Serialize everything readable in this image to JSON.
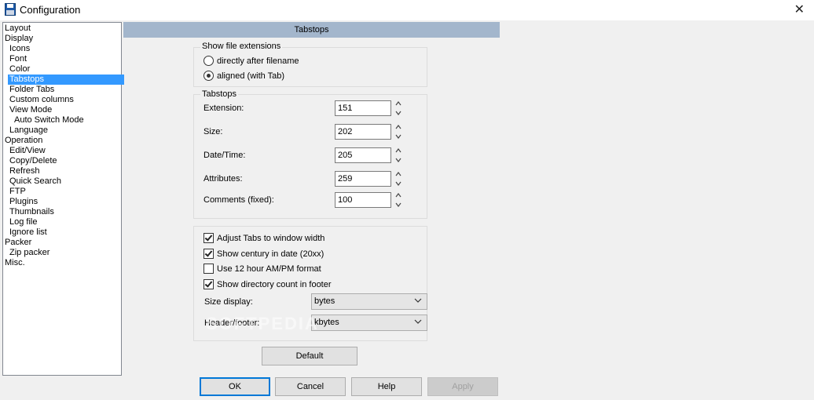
{
  "window": {
    "title": "Configuration",
    "close_glyph": "✕"
  },
  "tree": {
    "items": [
      {
        "label": "Layout",
        "indent": 0
      },
      {
        "label": "Display",
        "indent": 0
      },
      {
        "label": "Icons",
        "indent": 1
      },
      {
        "label": "Font",
        "indent": 1
      },
      {
        "label": "Color",
        "indent": 1
      },
      {
        "label": "Tabstops",
        "indent": 1,
        "selected": true
      },
      {
        "label": "Folder Tabs",
        "indent": 1
      },
      {
        "label": "Custom columns",
        "indent": 1
      },
      {
        "label": "View Mode",
        "indent": 1
      },
      {
        "label": "Auto Switch Mode",
        "indent": 2
      },
      {
        "label": "Language",
        "indent": 1
      },
      {
        "label": "Operation",
        "indent": 0
      },
      {
        "label": "Edit/View",
        "indent": 1
      },
      {
        "label": "Copy/Delete",
        "indent": 1
      },
      {
        "label": "Refresh",
        "indent": 1
      },
      {
        "label": "Quick Search",
        "indent": 1
      },
      {
        "label": "FTP",
        "indent": 1
      },
      {
        "label": "Plugins",
        "indent": 1
      },
      {
        "label": "Thumbnails",
        "indent": 1
      },
      {
        "label": "Log file",
        "indent": 1
      },
      {
        "label": "Ignore list",
        "indent": 1
      },
      {
        "label": "Packer",
        "indent": 0
      },
      {
        "label": "Zip packer",
        "indent": 1
      },
      {
        "label": "Misc.",
        "indent": 0
      }
    ]
  },
  "page": {
    "header": "Tabstops"
  },
  "show_ext": {
    "title": "Show file extensions",
    "options": [
      {
        "label": "directly after filename",
        "checked": false
      },
      {
        "label": "aligned (with Tab)",
        "checked": true
      }
    ]
  },
  "tabstops": {
    "title": "Tabstops",
    "fields": [
      {
        "label": "Extension:",
        "value": "151"
      },
      {
        "label": "Size:",
        "value": "202"
      },
      {
        "label": "Date/Time:",
        "value": "205"
      },
      {
        "label": "Attributes:",
        "value": "259"
      },
      {
        "label": "Comments (fixed):",
        "value": "100"
      }
    ]
  },
  "options": {
    "checkboxes": [
      {
        "label": "Adjust Tabs to window width",
        "checked": true
      },
      {
        "label": "Show century in date (20xx)",
        "checked": true
      },
      {
        "label": "Use 12 hour AM/PM format",
        "checked": false
      },
      {
        "label": "Show directory count in footer",
        "checked": true
      }
    ],
    "size_display": {
      "label": "Size display:",
      "value": "bytes"
    },
    "header_footer": {
      "label": "Header/footer:",
      "value": "kbytes"
    }
  },
  "buttons": {
    "default": "Default",
    "ok": "OK",
    "cancel": "Cancel",
    "help": "Help",
    "apply": "Apply"
  },
  "watermark": "SOFTPEDIA"
}
